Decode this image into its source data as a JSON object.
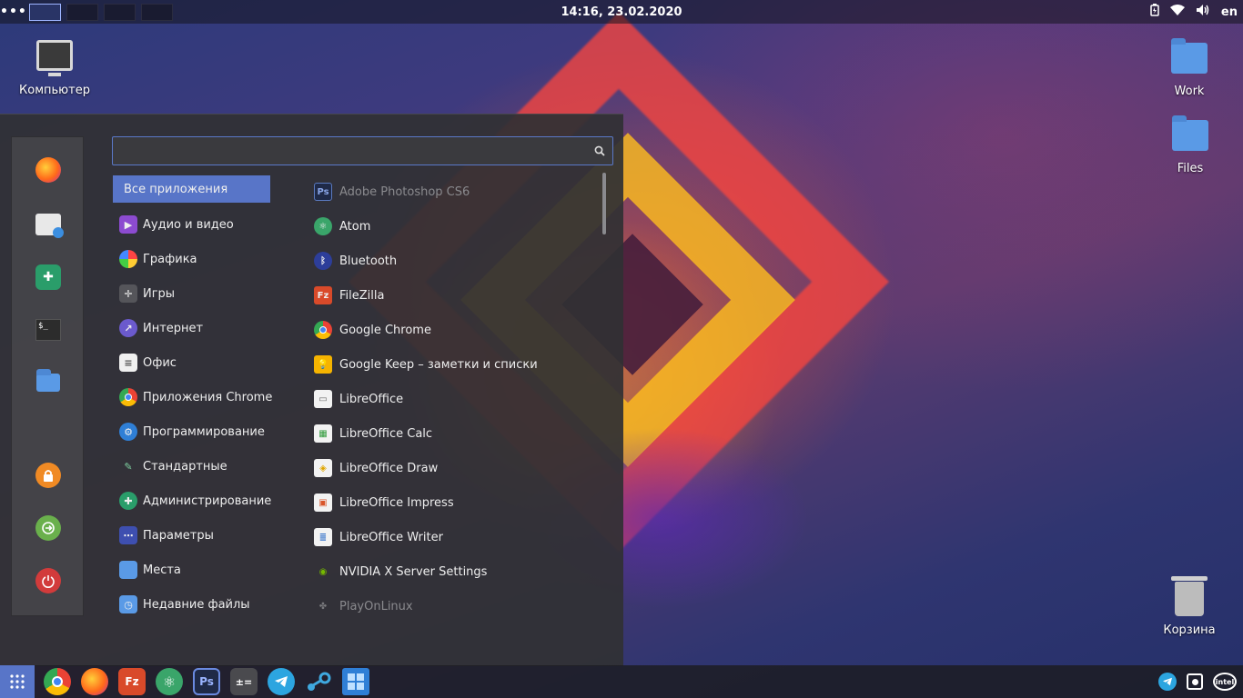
{
  "topbar": {
    "menu_dots": "•••",
    "workspaces_count": 4,
    "active_workspace": 1,
    "clock": "14:16, 23.02.2020",
    "language": "en"
  },
  "desktop": {
    "computer_label": "Компьютер",
    "work_label": "Work",
    "files_label": "Files",
    "trash_label": "Корзина"
  },
  "menu": {
    "search_value": "",
    "categories": [
      {
        "label": "Все приложения",
        "selected": true
      },
      {
        "label": "Аудио и видео"
      },
      {
        "label": "Графика"
      },
      {
        "label": "Игры"
      },
      {
        "label": "Интернет"
      },
      {
        "label": "Офис"
      },
      {
        "label": "Приложения Chrome"
      },
      {
        "label": "Программирование"
      },
      {
        "label": "Стандартные"
      },
      {
        "label": "Администрирование"
      },
      {
        "label": "Параметры"
      },
      {
        "label": "Места"
      },
      {
        "label": "Недавние файлы"
      }
    ],
    "apps": [
      {
        "label": "Adobe Photoshop CS6",
        "dim": true
      },
      {
        "label": "Atom"
      },
      {
        "label": "Bluetooth"
      },
      {
        "label": "FileZilla"
      },
      {
        "label": "Google Chrome"
      },
      {
        "label": "Google Keep – заметки и списки"
      },
      {
        "label": "LibreOffice"
      },
      {
        "label": "LibreOffice Calc"
      },
      {
        "label": "LibreOffice Draw"
      },
      {
        "label": "LibreOffice Impress"
      },
      {
        "label": "LibreOffice Writer"
      },
      {
        "label": "NVIDIA X Server Settings"
      },
      {
        "label": "PlayOnLinux",
        "dim": true
      }
    ]
  },
  "icons": {
    "photoshop": "Ps",
    "filezilla": "Fz",
    "terminal": "$_"
  },
  "colors": {
    "accent": "#5875c8",
    "menu_bg": "#303034"
  }
}
